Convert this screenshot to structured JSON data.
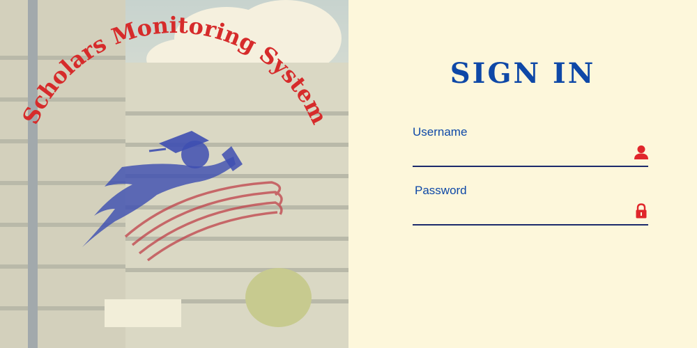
{
  "brand": {
    "logo_text": "Scholars Monitoring System"
  },
  "signin": {
    "title": "SIGN IN",
    "username_label": "Username",
    "username_value": "",
    "password_label": "Password",
    "password_value": ""
  },
  "icons": {
    "username": "user-icon",
    "password": "lock-icon"
  },
  "colors": {
    "accent": "#0e48a7",
    "icon": "#e0262b",
    "panel_background": "#fdf7db"
  }
}
